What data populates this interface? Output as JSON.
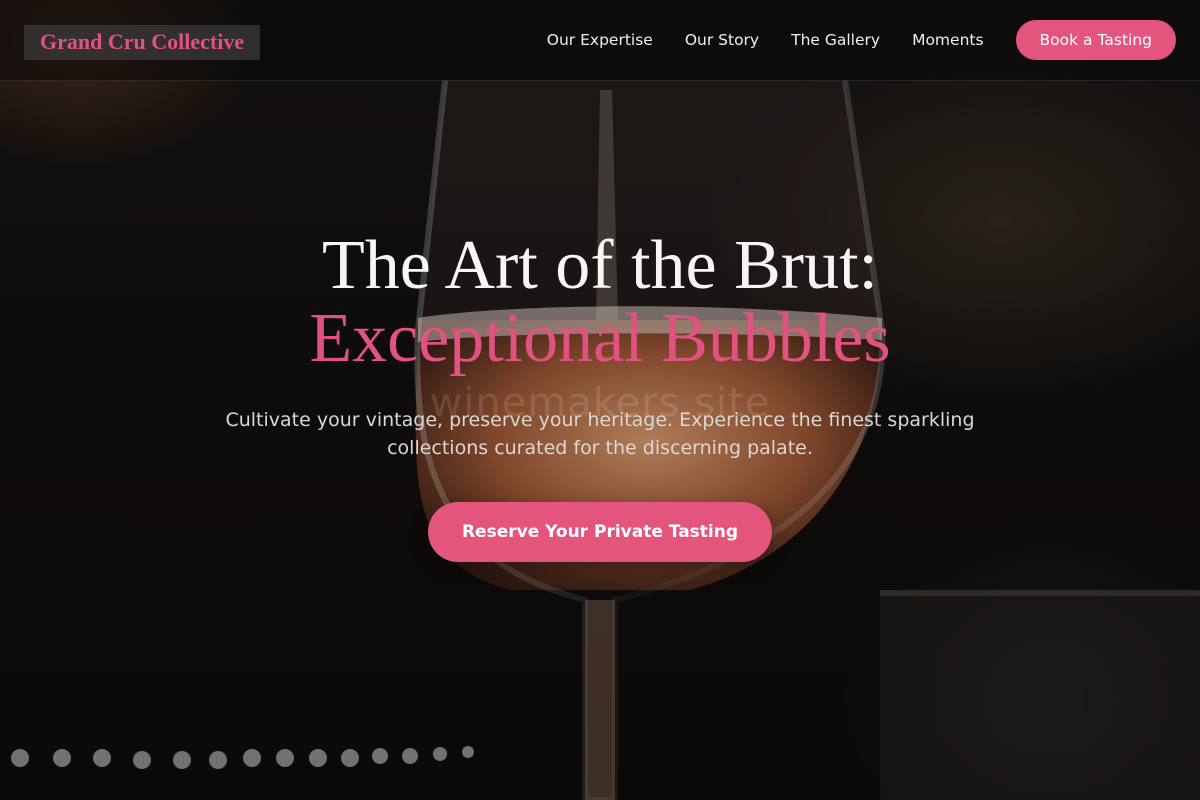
{
  "nav": {
    "brand": "Grand Cru Collective",
    "links": [
      "Our Expertise",
      "Our Story",
      "The Gallery",
      "Moments"
    ],
    "cta": "Book a Tasting"
  },
  "hero": {
    "title_line1": "The Art of the Brut:",
    "title_line2": "Exceptional Bubbles",
    "subtitle": "Cultivate your vintage, preserve your heritage. Experience the finest sparkling collections curated for the discerning palate.",
    "cta": "Reserve Your Private Tasting"
  },
  "watermark": "winemakers.site",
  "colors": {
    "accent": "#e4557e",
    "brand_text": "#e0527f",
    "background": "#0d0b0a"
  },
  "icons": [
    "champagne-glass-photo"
  ]
}
